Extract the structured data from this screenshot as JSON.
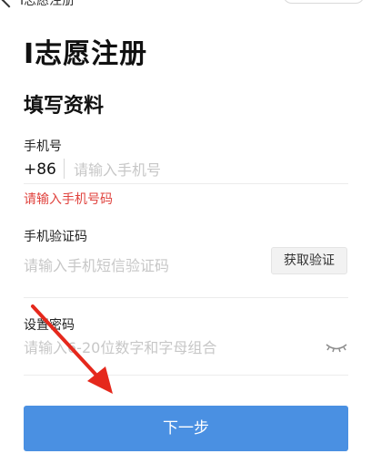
{
  "nav": {
    "title": "I志愿注册",
    "back_icon": "back-arrow-icon",
    "close_icon": "close-circle-icon"
  },
  "page": {
    "title": "I志愿注册",
    "section_title": "填写资料"
  },
  "phone": {
    "label": "手机号",
    "prefix": "+86",
    "placeholder": "请输入手机号",
    "value": "",
    "error": "请输入手机号码"
  },
  "code": {
    "label": "手机验证码",
    "placeholder": "请输入手机短信验证码",
    "value": "",
    "button": "获取验证"
  },
  "password": {
    "label": "设置密码",
    "placeholder": "请输入6-20位数字和字母组合",
    "value": "",
    "toggle_icon": "eye-closed-icon"
  },
  "actions": {
    "next": "下一步"
  },
  "colors": {
    "primary": "#4a90e2",
    "error": "#e0433e",
    "annotation": "#e5281c"
  }
}
